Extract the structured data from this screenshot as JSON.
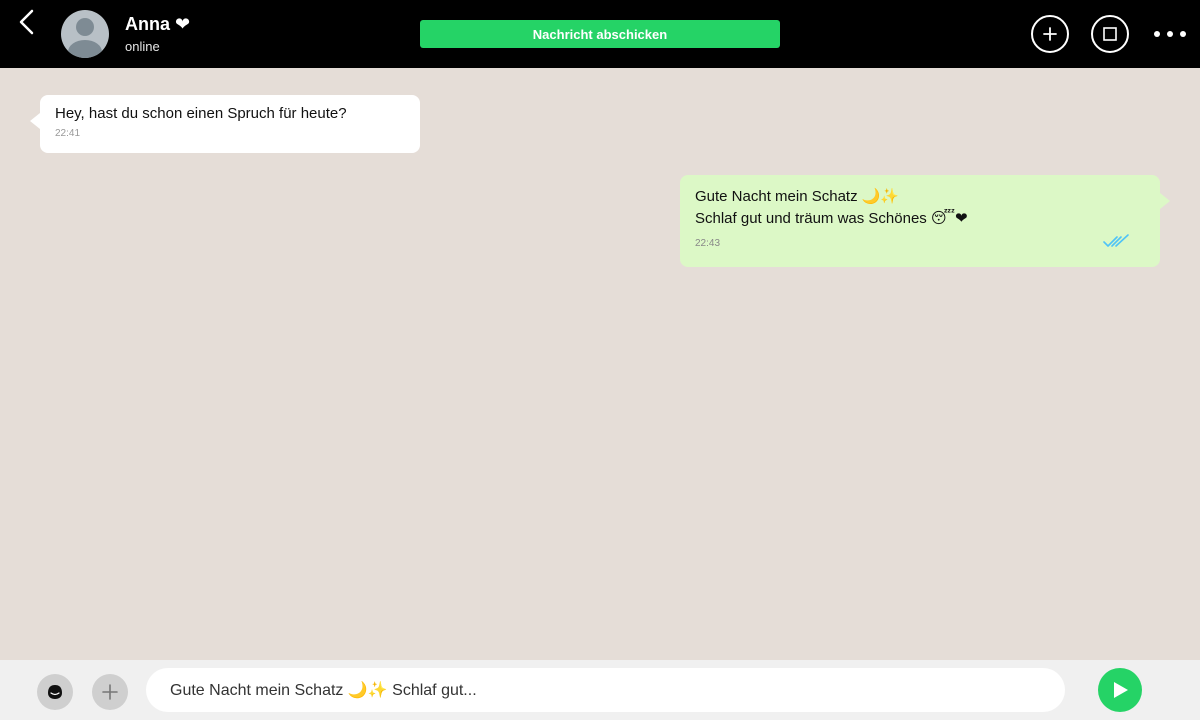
{
  "header": {
    "contact_name": "Anna ❤",
    "status": "online",
    "send_button_label": "Nachricht abschicken",
    "icons": [
      "back-arrow-icon",
      "avatar-placeholder-icon",
      "plus-icon",
      "square-icon",
      "more-icon"
    ]
  },
  "messages": [
    {
      "direction": "incoming",
      "text": "Hey, hast du schon einen Spruch für heute?",
      "time": "22:41"
    },
    {
      "direction": "outgoing",
      "line1": "Gute Nacht mein Schatz 🌙✨",
      "line2": "Schlaf gut und träum was Schönes 😴❤",
      "time": "22:43",
      "status_icon": "double-check-icon"
    }
  ],
  "composer": {
    "input_value": "Gute Nacht mein Schatz 🌙✨ Schlaf gut...",
    "icons": [
      "emoji-icon",
      "attach-plus-icon",
      "send-icon"
    ]
  },
  "colors": {
    "topbar": "#000000",
    "background": "#e5ddd7",
    "accent_green": "#25d366",
    "outgoing_bubble": "#dcf8c6",
    "incoming_bubble": "#ffffff",
    "read_ticks": "#4fc3f7"
  }
}
